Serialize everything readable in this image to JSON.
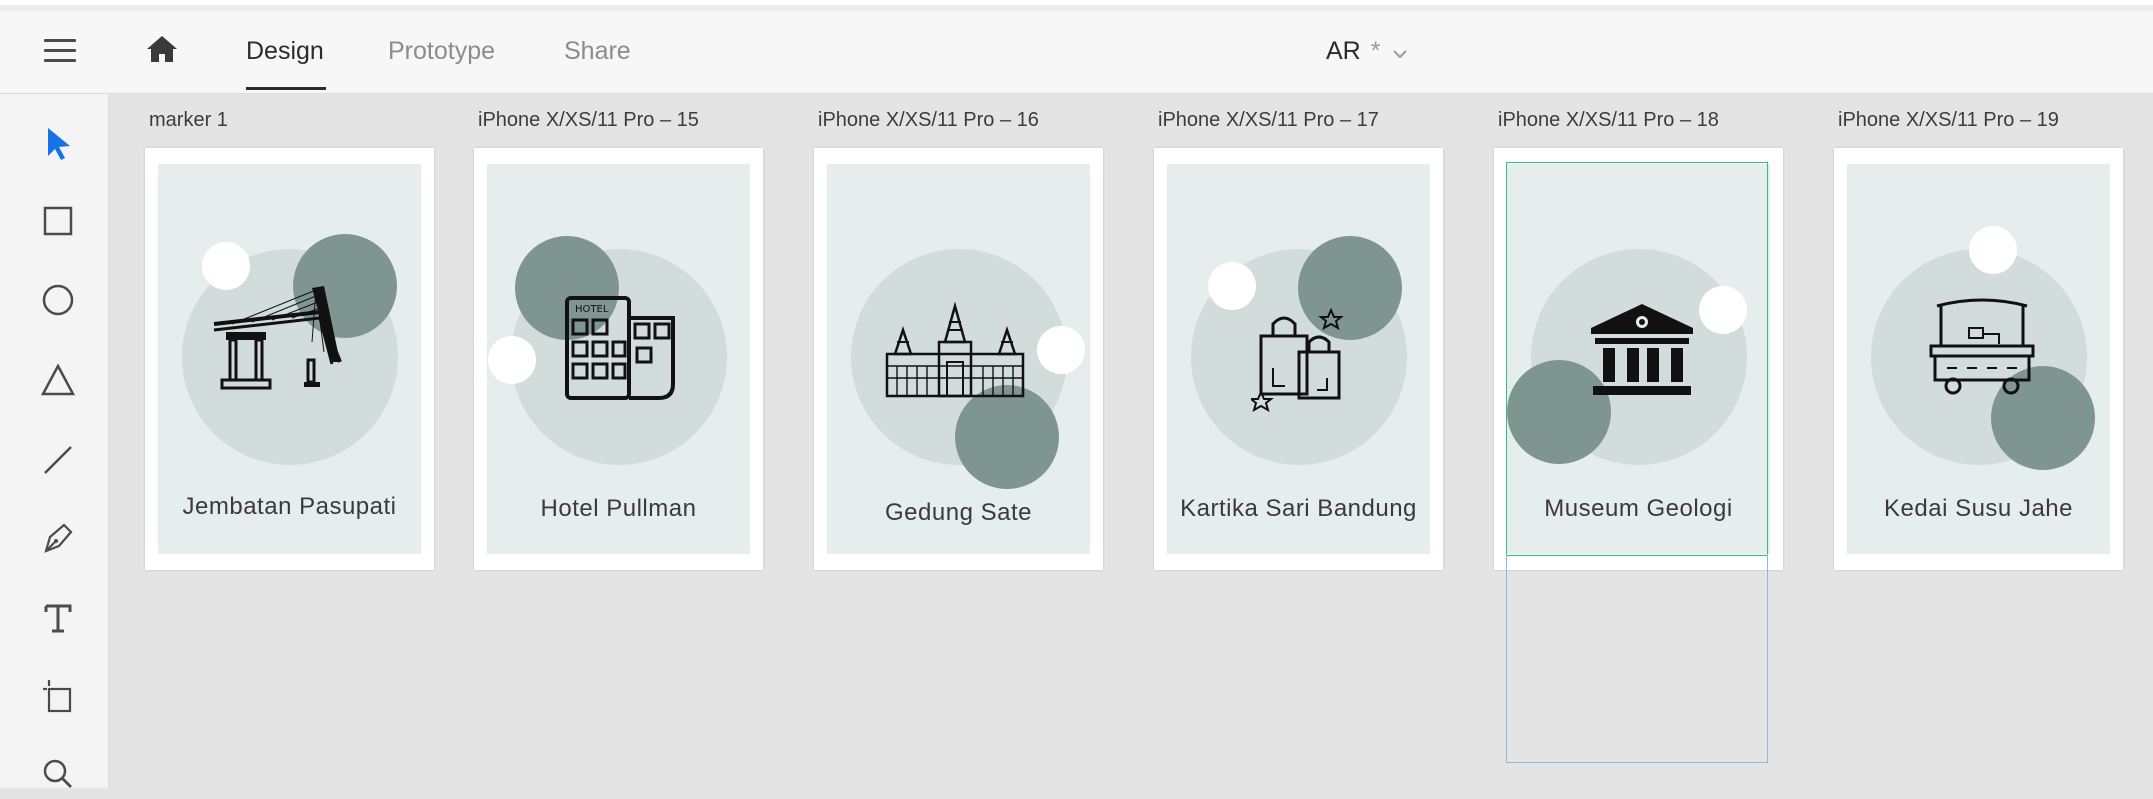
{
  "header": {
    "tabs": [
      {
        "label": "Design",
        "active": true
      },
      {
        "label": "Prototype",
        "active": false
      },
      {
        "label": "Share",
        "active": false
      }
    ],
    "document_title": "AR",
    "unsaved_marker": "*"
  },
  "toolbar": {
    "tools": [
      "select-tool",
      "rectangle-tool",
      "ellipse-tool",
      "triangle-tool",
      "line-tool",
      "pen-tool",
      "text-tool",
      "artboard-tool",
      "zoom-tool"
    ]
  },
  "artboards": [
    {
      "label": "marker 1",
      "title": "Jembatan Pasupati",
      "icon": "bridge-icon"
    },
    {
      "label": "iPhone X/XS/11 Pro – 15",
      "title": "Hotel Pullman",
      "icon": "hotel-icon",
      "icon_text": "HOTEL"
    },
    {
      "label": "iPhone X/XS/11 Pro – 16",
      "title": "Gedung Sate",
      "icon": "palace-icon"
    },
    {
      "label": "iPhone X/XS/11 Pro – 17",
      "title": "Kartika Sari Bandung",
      "icon": "shopping-bags-icon"
    },
    {
      "label": "iPhone X/XS/11 Pro – 18",
      "title": "Museum Geologi",
      "icon": "museum-icon",
      "selected": true
    },
    {
      "label": "iPhone X/XS/11 Pro – 19",
      "title": "Kedai Susu Jahe",
      "icon": "food-cart-icon"
    }
  ],
  "colors": {
    "card_bg": "#e6eeed",
    "accent_dark_circle": "#7f9590",
    "selection_green": "#33c27a",
    "selection_blue": "#8fb8dc",
    "select_tool": "#1473e6"
  }
}
